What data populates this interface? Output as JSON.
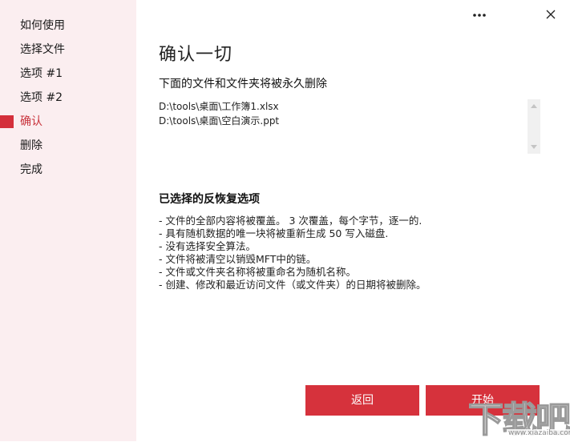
{
  "sidebar": {
    "items": [
      {
        "label": "如何使用"
      },
      {
        "label": "选择文件"
      },
      {
        "label": "选项 #1"
      },
      {
        "label": "选项 #2"
      },
      {
        "label": "确认"
      },
      {
        "label": "删除"
      },
      {
        "label": "完成"
      }
    ],
    "active_index": 4
  },
  "colors": {
    "accent": "#d6323c",
    "sidebar_bg": "#fbeef0"
  },
  "window_controls": {
    "more_icon": "more-dots-icon",
    "close_icon": "close-icon"
  },
  "main": {
    "title": "确认一切",
    "subtitle": "下面的文件和文件夹将被永久删除",
    "files": [
      "D:\\tools\\桌面\\工作簿1.xlsx",
      "D:\\tools\\桌面\\空白演示.ppt"
    ],
    "options_title": "已选择的反恢复选项",
    "options": [
      "- 文件的全部内容将被覆盖。 3 次覆盖，每个字节，逐一的.",
      "- 具有随机数据的唯一块将被重新生成 50 写入磁盘.",
      "- 没有选择安全算法。",
      "- 文件将被清空以销毁MFT中的链。",
      "- 文件或文件夹名称将被重命名为随机名称。",
      "- 创建、修改和最近访问文件（或文件夹）的日期将被删除。"
    ]
  },
  "buttons": {
    "back_label": "返回",
    "start_label": "开始"
  },
  "watermark": {
    "text": "下载吧",
    "url": "www.xiazaiba.com"
  }
}
